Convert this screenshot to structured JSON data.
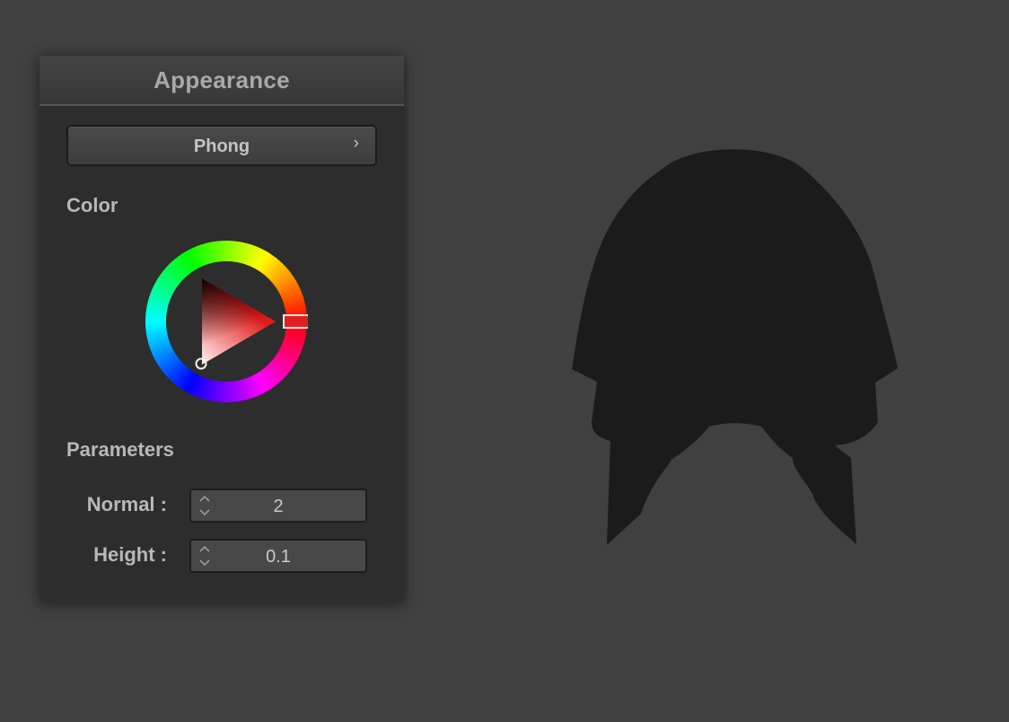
{
  "panel": {
    "title": "Appearance",
    "shader_button": {
      "label": "Phong",
      "icon": "chevron-right-icon"
    },
    "color_section": {
      "label": "Color",
      "selected_color": "#e02020",
      "hue": "red"
    },
    "parameters_section": {
      "label": "Parameters",
      "fields": [
        {
          "label": "Normal :",
          "value": "2"
        },
        {
          "label": "Height :",
          "value": "0.1"
        }
      ]
    }
  },
  "colors": {
    "viewport_background": "#404040",
    "panel_background": "#2d2d2d",
    "object_fill": "#1b1b1b"
  }
}
